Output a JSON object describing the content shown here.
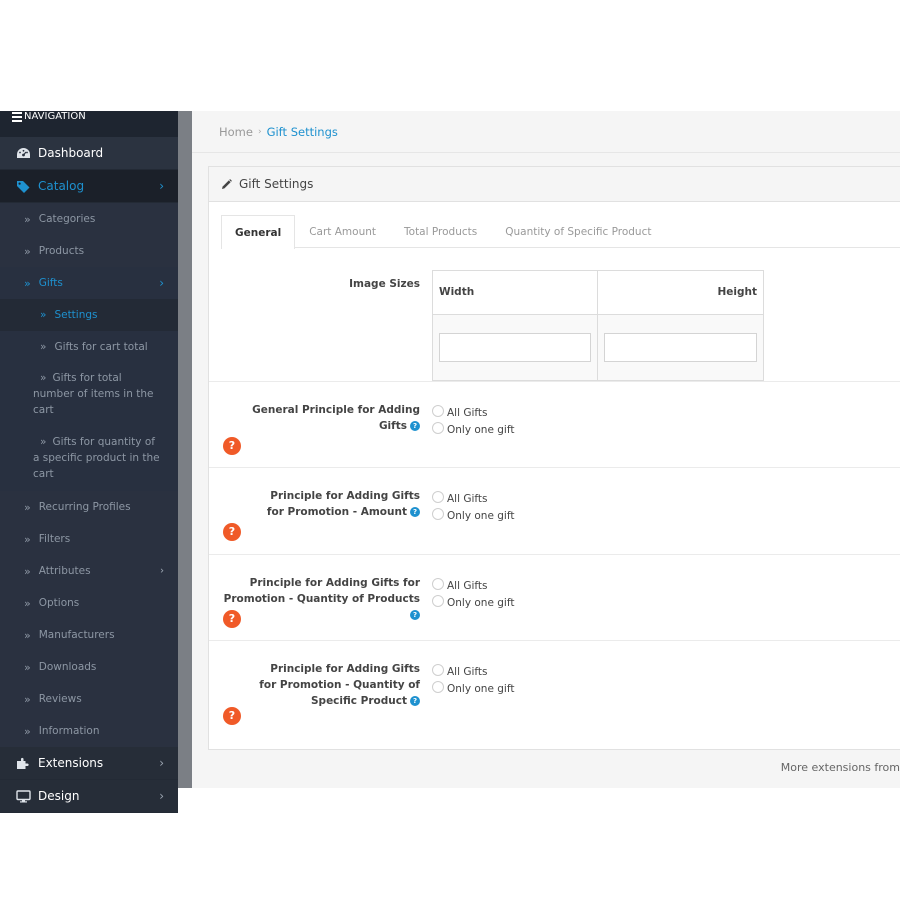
{
  "sidebar": {
    "header": "NAVIGATION",
    "dashboard": "Dashboard",
    "catalog": "Catalog",
    "catalog_items": {
      "categories": "Categories",
      "products": "Products",
      "gifts": "Gifts",
      "recurring": "Recurring Profiles",
      "filters": "Filters",
      "attributes": "Attributes",
      "options": "Options",
      "manufacturers": "Manufacturers",
      "downloads": "Downloads",
      "reviews": "Reviews",
      "information": "Information"
    },
    "gifts_items": {
      "settings": "Settings",
      "cart_total": "Gifts for cart total",
      "total_number": "Gifts for total number of items in the cart",
      "specific_qty": "Gifts for quantity of a specific product in the cart"
    },
    "extensions": "Extensions",
    "design": "Design",
    "accent_color": "#1e91cf"
  },
  "breadcrumb": {
    "home": "Home",
    "separator": "›",
    "current": "Gift Settings"
  },
  "panel": {
    "title": "Gift Settings",
    "tabs": [
      "General",
      "Cart Amount",
      "Total Products",
      "Quantity of Specific Product"
    ],
    "active_tab": "General",
    "image_sizes": {
      "label": "Image Sizes",
      "width_header": "Width",
      "height_header": "Height",
      "width_value": "",
      "height_value": ""
    },
    "principles": [
      {
        "label": "General Principle for Adding Gifts",
        "options": [
          "All Gifts",
          "Only one gift"
        ],
        "selected": null
      },
      {
        "label": "Principle for Adding Gifts for Promotion - Amount",
        "options": [
          "All Gifts",
          "Only one gift"
        ],
        "selected": null
      },
      {
        "label": "Principle for Adding Gifts for Promotion - Quantity of Products",
        "options": [
          "All Gifts",
          "Only one gift"
        ],
        "selected": null
      },
      {
        "label": "Principle for Adding Gifts for Promotion - Quantity of Specific Product",
        "options": [
          "All Gifts",
          "Only one gift"
        ],
        "selected": null
      }
    ],
    "help_glyph": "?",
    "warning_glyph": "?"
  },
  "footer": {
    "text": "More extensions from"
  }
}
